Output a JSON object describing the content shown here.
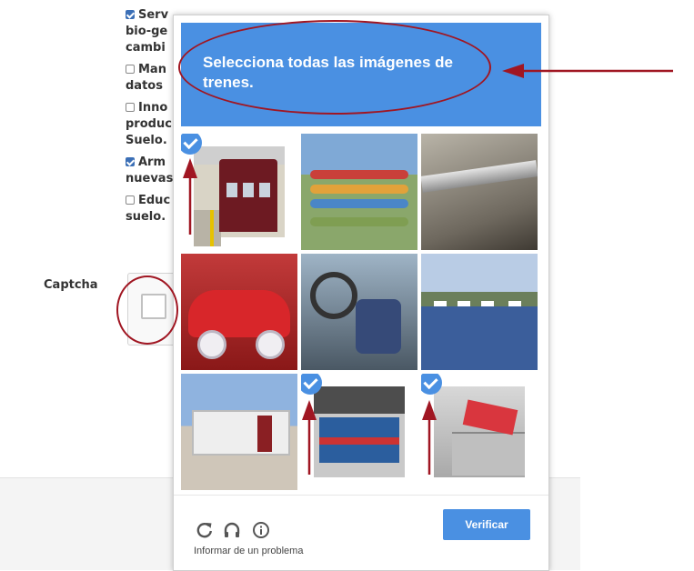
{
  "form": {
    "options": [
      {
        "checked": true,
        "text": "Serv"
      },
      {
        "checked": false,
        "text": ""
      },
      {
        "checked": false,
        "text": ""
      },
      {
        "checked": false,
        "text": ""
      },
      {
        "checked": true,
        "text": ""
      },
      {
        "checked": false,
        "text": ""
      }
    ],
    "lines": [
      [
        "Serv",
        "bio-ge",
        "cambi"
      ],
      [
        "Man",
        "datos"
      ],
      [
        "Inno",
        "produc",
        "Suelo."
      ],
      [
        "Arm",
        "nuevas"
      ],
      [
        "Educ",
        "suelo."
      ]
    ],
    "captcha_label": "Captcha"
  },
  "captcha": {
    "instruction_prefix": "Selecciona todas las imágenes de",
    "instruction_target": "trenes.",
    "tiles": [
      {
        "scene": "train-station",
        "selected": true
      },
      {
        "scene": "canoes-rack",
        "selected": false
      },
      {
        "scene": "ceiling-ducts",
        "selected": false
      },
      {
        "scene": "red-car",
        "selected": false
      },
      {
        "scene": "car-interior",
        "selected": false
      },
      {
        "scene": "harbor",
        "selected": false
      },
      {
        "scene": "building",
        "selected": false
      },
      {
        "scene": "blue-train",
        "selected": true
      },
      {
        "scene": "red-train-model",
        "selected": true
      }
    ],
    "icons": [
      "reload-icon",
      "headphones-icon",
      "info-icon"
    ],
    "report_text": "Informar de un problema",
    "verify_label": "Verificar"
  },
  "colors": {
    "header_blue": "#4a90e2",
    "annotation_red": "#a01622"
  }
}
